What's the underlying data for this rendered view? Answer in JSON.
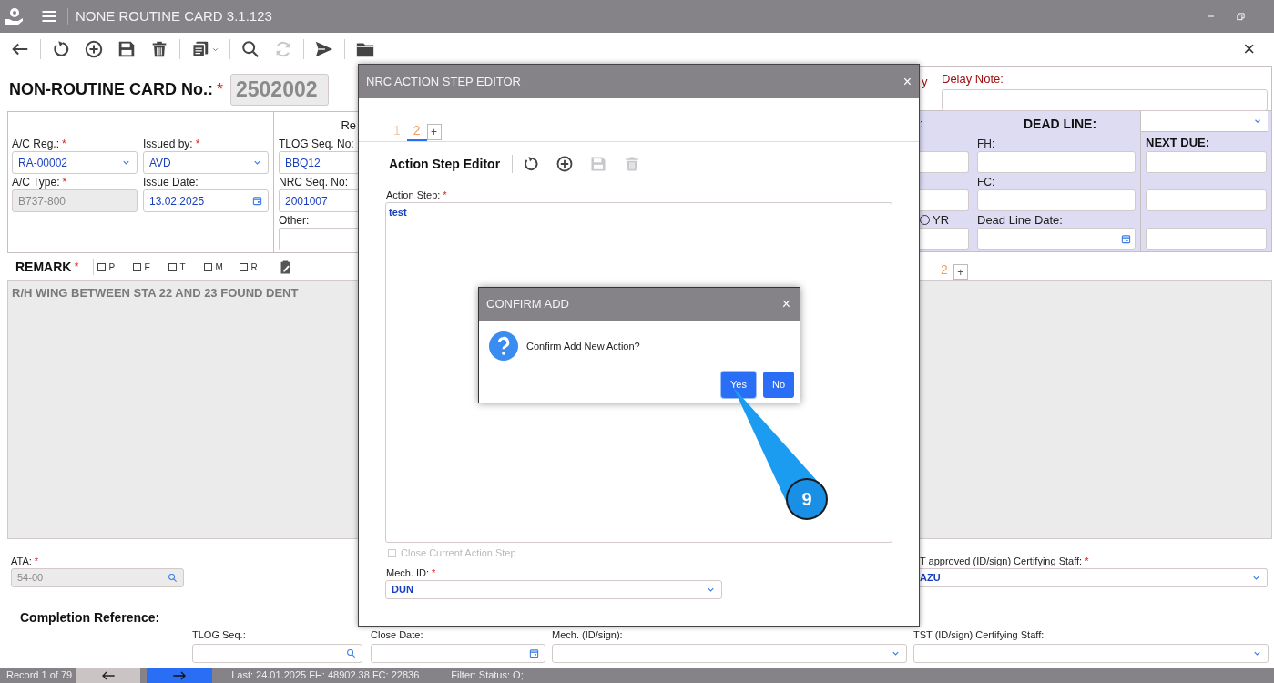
{
  "window": {
    "title": "NONE ROUTINE CARD 3.1.123",
    "close": "×"
  },
  "tool_groups": [
    [
      {
        "kind": "back",
        "disabled": false
      }
    ],
    [
      {
        "kind": "undo",
        "disabled": false
      },
      {
        "kind": "add",
        "disabled": false
      },
      {
        "kind": "save",
        "disabled": false
      },
      {
        "kind": "delete",
        "disabled": false
      }
    ],
    [
      {
        "kind": "list",
        "disabled": false
      }
    ],
    [
      {
        "kind": "search",
        "disabled": false
      },
      {
        "kind": "refresh",
        "disabled": true
      }
    ],
    [
      {
        "kind": "send",
        "disabled": false
      }
    ],
    [
      {
        "kind": "folder",
        "disabled": false
      }
    ]
  ],
  "card_number": {
    "label": "NON-ROUTINE CARD No.:",
    "mark": "*",
    "value": "2502002"
  },
  "general_fields": [
    {
      "label": "A/C Reg.:",
      "mark": "*",
      "value": "RA-00002",
      "kind": "select"
    },
    {
      "label": "Issued by:",
      "mark": "*",
      "value": "AVD",
      "kind": "select"
    },
    {
      "label": "A/C Type:",
      "mark": "*",
      "value": "B737-800",
      "kind": "readonly"
    },
    {
      "label": "Issue Date:",
      "value": "13.02.2025",
      "kind": "date"
    }
  ],
  "reference": {
    "heading": "Re",
    "fields": [
      {
        "label": "TLOG Seq. No:",
        "value": "BBQ12"
      },
      {
        "label": "NRC Seq. No:",
        "value": "2001007"
      },
      {
        "label": "Other:"
      }
    ]
  },
  "delay": {
    "cut_label": "y",
    "label": "Delay Note:"
  },
  "deadline": {
    "cut_label": ":",
    "title": "DEAD LINE:",
    "radio": {
      "label": "YR",
      "selected": false
    },
    "fh_label": "FH:",
    "fc_label": "FC:",
    "date_label": "Dead Line Date:",
    "next_due": "NEXT DUE:"
  },
  "remark": {
    "label": "REMARK",
    "mark": "*",
    "flags": [
      {
        "label": "P",
        "checked": false
      },
      {
        "label": "E",
        "checked": false
      },
      {
        "label": "T",
        "checked": false
      },
      {
        "label": "M",
        "checked": false
      },
      {
        "label": "R",
        "checked": false
      }
    ],
    "text": "R/H WING BETWEEN STA 22 AND 23 FOUND DENT"
  },
  "action_tabs": {
    "tabs": [
      {
        "label": "2"
      }
    ],
    "add": "+"
  },
  "ata": {
    "label": "ATA:",
    "mark": "*",
    "value": "54-00"
  },
  "certifying": {
    "label": "T approved (ID/sign) Certifying Staff:",
    "mark": "*",
    "value": "AZU"
  },
  "completion": {
    "title": "Completion Reference:",
    "fields": [
      {
        "label": "TLOG Seq.:",
        "kind": "search"
      },
      {
        "label": "Close Date:",
        "kind": "date"
      },
      {
        "label": "Mech. (ID/sign):",
        "kind": "select"
      },
      {
        "label": "TST (ID/sign) Certifying Staff:",
        "kind": "select"
      }
    ]
  },
  "status_bar": {
    "record": "Record 1 of 79",
    "last": "Last: 24.01.2025 FH: 48902.38 FC: 22836",
    "filter": "Filter: Status: O;"
  },
  "editor_dialog": {
    "title": "NRC ACTION STEP EDITOR",
    "close": "×",
    "tabs": [
      {
        "label": "1",
        "selected": false
      },
      {
        "label": "2",
        "selected": true
      }
    ],
    "add_tab": "+",
    "toolbar_title": "Action Step Editor",
    "tools": [
      {
        "kind": "undo",
        "disabled": false
      },
      {
        "kind": "add",
        "disabled": false
      },
      {
        "kind": "save",
        "disabled": true
      },
      {
        "kind": "delete",
        "disabled": true
      }
    ],
    "step_label": "Action Step:",
    "step_mark": "*",
    "step_text": "test",
    "close_step": {
      "label": "Close Current Action Step",
      "checked": false,
      "disabled": true
    },
    "mech_label": "Mech. ID:",
    "mech_mark": "*",
    "mech_value": "DUN"
  },
  "confirm_dialog": {
    "title": "CONFIRM ADD",
    "close": "×",
    "message": "Confirm Add New Action?",
    "buttons": [
      {
        "label": "Yes"
      },
      {
        "label": "No"
      }
    ]
  },
  "callout": {
    "number": "9"
  }
}
